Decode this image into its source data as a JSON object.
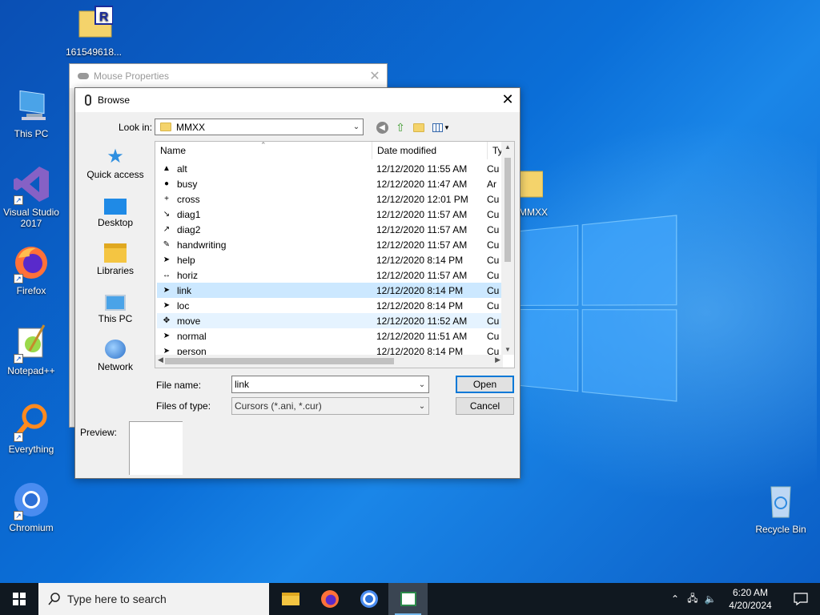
{
  "desktop": {
    "icons": [
      {
        "id": "file",
        "label": "161549618..."
      },
      {
        "id": "this_pc",
        "label": "This PC"
      },
      {
        "id": "vs",
        "label": "Visual Studio 2017"
      },
      {
        "id": "firefox",
        "label": "Firefox"
      },
      {
        "id": "notepadpp",
        "label": "Notepad++"
      },
      {
        "id": "everything",
        "label": "Everything"
      },
      {
        "id": "chromium",
        "label": "Chromium"
      },
      {
        "id": "mmxx",
        "label": "MMXX"
      },
      {
        "id": "recycle",
        "label": "Recycle Bin"
      }
    ]
  },
  "mouse_properties": {
    "title": "Mouse Properties",
    "close": "✕"
  },
  "browse": {
    "title": "Browse",
    "close": "✕",
    "look_in_label": "Look in:",
    "look_in_value": "MMXX",
    "places": [
      "Quick access",
      "Desktop",
      "Libraries",
      "This PC",
      "Network"
    ],
    "columns": [
      "Name",
      "Date modified",
      "Ty"
    ],
    "files": [
      {
        "name": "alt",
        "date": "12/12/2020 11:55 AM",
        "type": "Cu"
      },
      {
        "name": "busy",
        "date": "12/12/2020 11:47 AM",
        "type": "Ar"
      },
      {
        "name": "cross",
        "date": "12/12/2020 12:01 PM",
        "type": "Cu"
      },
      {
        "name": "diag1",
        "date": "12/12/2020 11:57 AM",
        "type": "Cu"
      },
      {
        "name": "diag2",
        "date": "12/12/2020 11:57 AM",
        "type": "Cu"
      },
      {
        "name": "handwriting",
        "date": "12/12/2020 11:57 AM",
        "type": "Cu"
      },
      {
        "name": "help",
        "date": "12/12/2020 8:14 PM",
        "type": "Cu"
      },
      {
        "name": "horiz",
        "date": "12/12/2020 11:57 AM",
        "type": "Cu"
      },
      {
        "name": "link",
        "date": "12/12/2020 8:14 PM",
        "type": "Cu"
      },
      {
        "name": "loc",
        "date": "12/12/2020 8:14 PM",
        "type": "Cu"
      },
      {
        "name": "move",
        "date": "12/12/2020 11:52 AM",
        "type": "Cu"
      },
      {
        "name": "normal",
        "date": "12/12/2020 11:51 AM",
        "type": "Cu"
      },
      {
        "name": "person",
        "date": "12/12/2020 8:14 PM",
        "type": "Cu"
      }
    ],
    "selected_file": "link",
    "hovered_file": "move",
    "file_name_label": "File name:",
    "file_name_value": "link",
    "files_of_type_label": "Files of type:",
    "files_of_type_value": "Cursors (*.ani, *.cur)",
    "open_label": "Open",
    "cancel_label": "Cancel",
    "preview_label": "Preview:"
  },
  "taskbar": {
    "search_placeholder": "Type here to search",
    "time": "6:20 AM",
    "date": "4/20/2024"
  },
  "colors": {
    "accent": "#0078d7",
    "selection": "#cce8ff",
    "taskbar": "#101820"
  }
}
